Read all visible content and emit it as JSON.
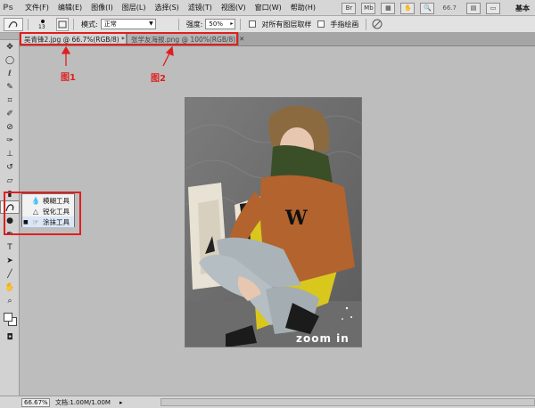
{
  "app": {
    "logo": "Ps",
    "workspace": "基本"
  },
  "menubar": {
    "items": [
      "文件(F)",
      "编辑(E)",
      "图像(I)",
      "图层(L)",
      "选择(S)",
      "滤镜(T)",
      "视图(V)",
      "窗口(W)",
      "帮助(H)"
    ],
    "zoom": "66.7"
  },
  "options": {
    "brush_size": "13",
    "mode_label": "模式:",
    "mode_value": "正常",
    "strength_label": "强度:",
    "strength_value": "50%",
    "sample_all_layers": "对所有图层取样",
    "finger_painting": "手指绘画"
  },
  "tabs": [
    {
      "label": "吴青锋2.jpg @ 66.7%(RGB/8) *",
      "active": true
    },
    {
      "label": "张学友海报.png @ 100%(RGB/8)",
      "active": false
    }
  ],
  "annotations": {
    "label1": "图1",
    "label2": "图2"
  },
  "flyout": {
    "items": [
      {
        "label": "模糊工具",
        "icon": "blur-drop-icon",
        "selected": false
      },
      {
        "label": "锐化工具",
        "icon": "sharpen-triangle-icon",
        "selected": false
      },
      {
        "label": "涂抹工具",
        "icon": "smudge-finger-icon",
        "selected": true
      }
    ]
  },
  "photo": {
    "watermark": "zoom in"
  },
  "status": {
    "zoom": "66.67%",
    "doc": "文档:1.00M/1.00M"
  },
  "colors": {
    "annotation": "#e01f1f",
    "canvas_bg": "#bdbdbd"
  }
}
